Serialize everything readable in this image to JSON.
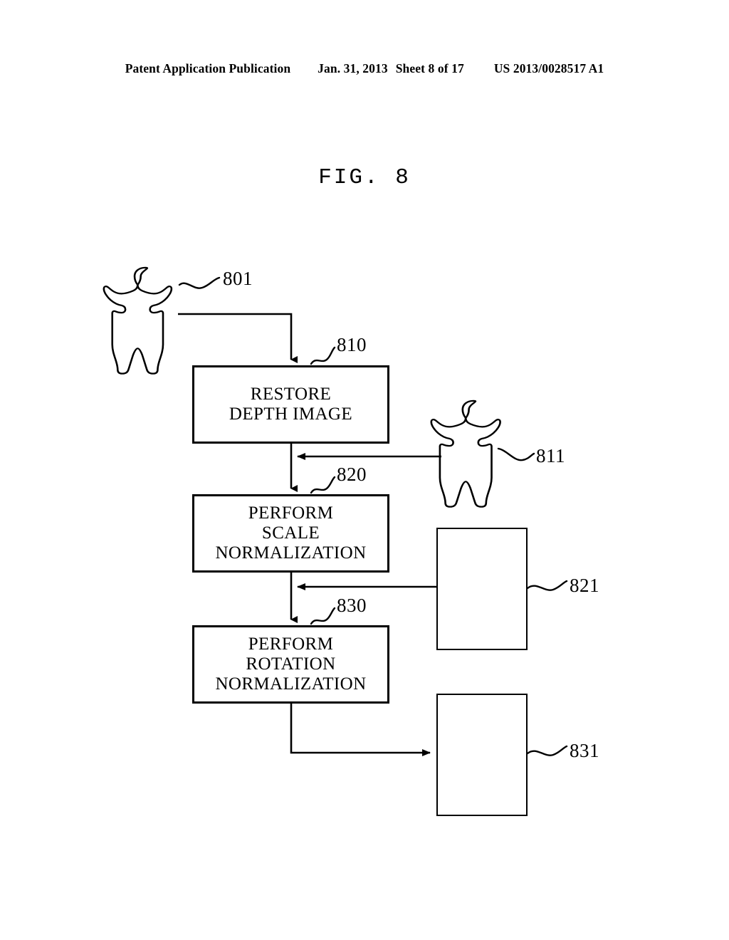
{
  "header": {
    "publication": "Patent Application Publication",
    "date": "Jan. 31, 2013",
    "sheet": "Sheet 8 of 17",
    "doc_number": "US 2013/0028517 A1"
  },
  "figure": {
    "title": "FIG. 8"
  },
  "flowchart": {
    "steps": [
      {
        "ref": "810",
        "lines": [
          "RESTORE",
          "DEPTH IMAGE"
        ]
      },
      {
        "ref": "820",
        "lines": [
          "PERFORM",
          "SCALE",
          "NORMALIZATION"
        ]
      },
      {
        "ref": "830",
        "lines": [
          "PERFORM",
          "ROTATION",
          "NORMALIZATION"
        ]
      }
    ],
    "images": [
      {
        "ref": "801",
        "kind": "human-silhouette",
        "framed": false
      },
      {
        "ref": "811",
        "kind": "human-silhouette",
        "framed": false
      },
      {
        "ref": "821",
        "kind": "human-silhouette",
        "framed": true
      },
      {
        "ref": "831",
        "kind": "human-silhouette-with-axes",
        "framed": true
      }
    ]
  },
  "colors": {
    "ink": "#000000",
    "paper": "#ffffff"
  }
}
